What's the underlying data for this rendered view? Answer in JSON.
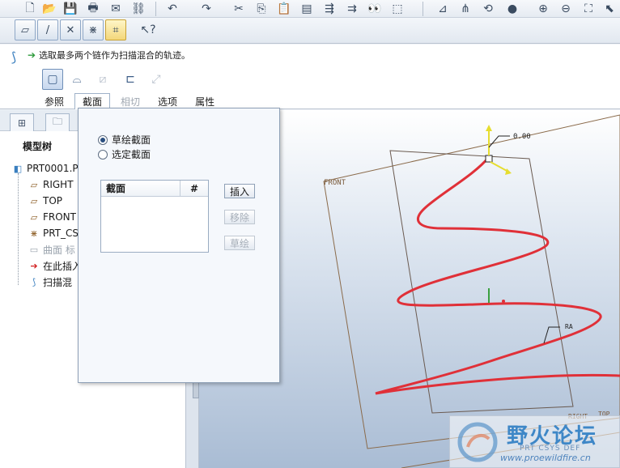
{
  "dashboard": {
    "message": "选取最多两个链作为扫描混合的轨迹。",
    "tabs": [
      "参照",
      "截面",
      "相切",
      "选项",
      "属性"
    ]
  },
  "model_tree": {
    "title": "模型树",
    "items": [
      "PRT0001.P",
      "RIGHT",
      "TOP",
      "FRONT",
      "PRT_CS",
      "曲面 标",
      "在此插入",
      "扫描混"
    ]
  },
  "section_panel": {
    "radio_sketch": "草绘截面",
    "radio_selected": "选定截面",
    "list_header_section": "截面",
    "list_header_number": "#",
    "btn_insert": "插入",
    "btn_remove": "移除",
    "btn_sketch": "草绘"
  },
  "viewport": {
    "front_label": "FRONT",
    "right_label": "RIGHT",
    "top_label": "TOP",
    "dimension_value": "0.00",
    "ra_label": "RA"
  },
  "watermark": {
    "title": "野火论坛",
    "subtitle": "PRT CSYS DEF",
    "url": "www.proewildfire.cn"
  },
  "colors": {
    "curve": "#e03038",
    "datum_plane": "#8a6a4a",
    "accent": "#3e87c7"
  }
}
